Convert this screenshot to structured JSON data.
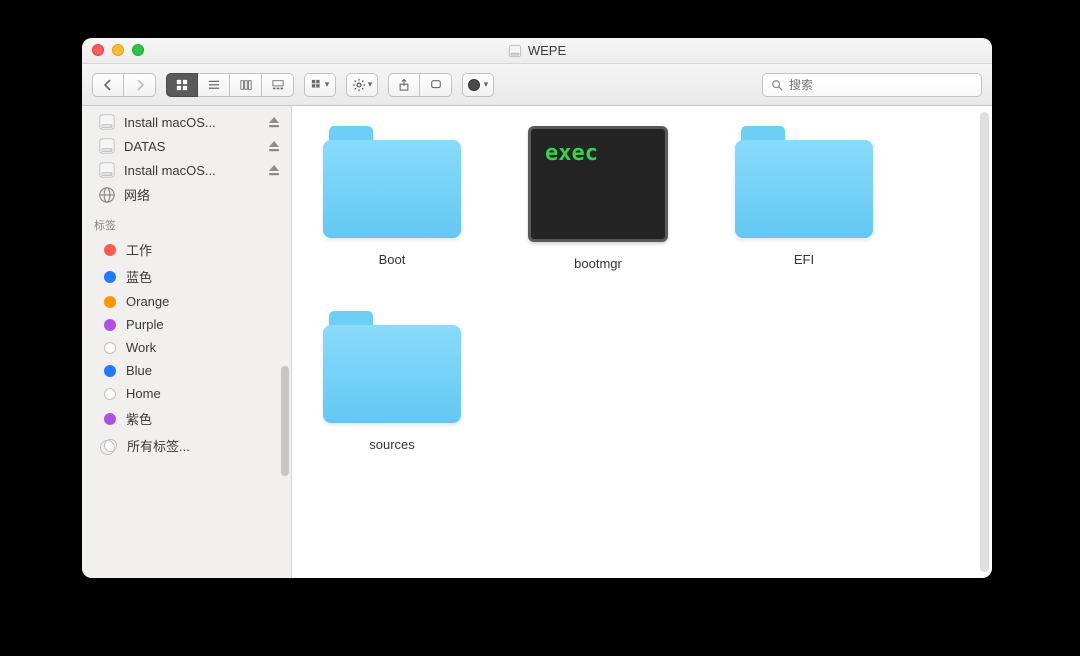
{
  "window": {
    "title": "WEPE"
  },
  "toolbar": {
    "search_placeholder": "搜索"
  },
  "sidebar": {
    "devices": [
      {
        "label": "Install macOS...",
        "ejectable": true
      },
      {
        "label": "DATAS",
        "ejectable": true
      },
      {
        "label": "Install macOS...",
        "ejectable": true
      }
    ],
    "network_label": "网络",
    "tags_header": "标签",
    "tags": [
      {
        "label": "工作",
        "color": "#ff5b54"
      },
      {
        "label": "蓝色",
        "color": "#1e7bff"
      },
      {
        "label": "Orange",
        "color": "#ff9500"
      },
      {
        "label": "Purple",
        "color": "#b150e4"
      },
      {
        "label": "Work",
        "color": "outline"
      },
      {
        "label": "Blue",
        "color": "#1e7bff"
      },
      {
        "label": "Home",
        "color": "outline"
      },
      {
        "label": "紫色",
        "color": "#b150e4"
      }
    ],
    "all_tags_label": "所有标签..."
  },
  "items": [
    {
      "name": "Boot",
      "kind": "folder"
    },
    {
      "name": "bootmgr",
      "kind": "exec",
      "exec_text": "exec"
    },
    {
      "name": "EFI",
      "kind": "folder"
    },
    {
      "name": "sources",
      "kind": "folder"
    }
  ]
}
